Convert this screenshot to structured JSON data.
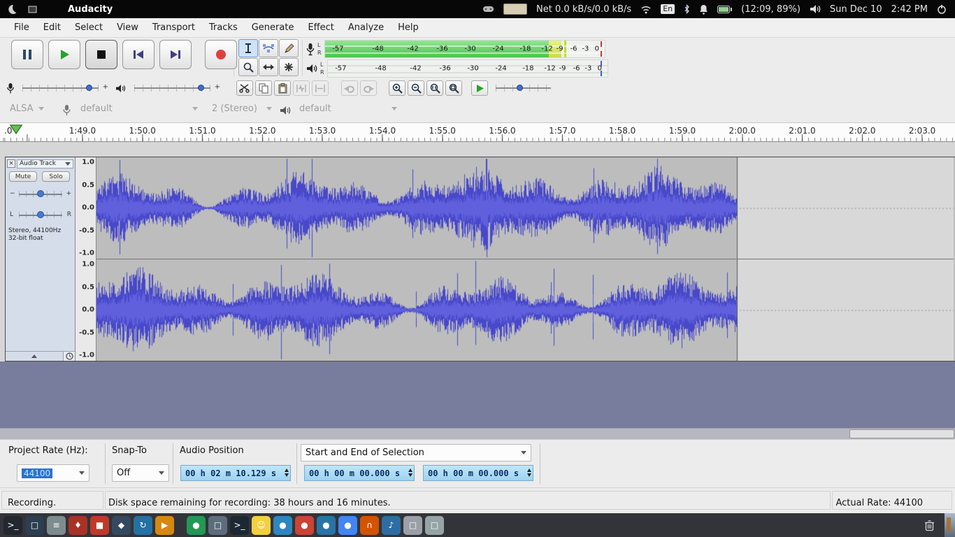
{
  "sysbar": {
    "app_title": "Audacity",
    "net": "Net 0.0 kB/s/0.0 kB/s",
    "lang": "En",
    "battery_text": "(12:09, 89%)",
    "date": "Sun Dec 10",
    "time": "2:42 PM"
  },
  "menubar": {
    "items": [
      "File",
      "Edit",
      "Select",
      "View",
      "Transport",
      "Tracks",
      "Generate",
      "Effect",
      "Analyze",
      "Help"
    ]
  },
  "meters": {
    "l": "L",
    "r": "R"
  },
  "meter_ticks": [
    "-57",
    "-48",
    "-42",
    "-36",
    "-30",
    "-24",
    "-18",
    "-12",
    "-9",
    "-6",
    "-3",
    "0"
  ],
  "mixer": {
    "plus": "+"
  },
  "device": {
    "host": "ALSA",
    "input": "default",
    "channels": "2 (Stereo)",
    "output": "default"
  },
  "timeline": {
    "partial": ".0",
    "labels": [
      "1:49.0",
      "1:50.0",
      "1:51.0",
      "1:52.0",
      "1:53.0",
      "1:54.0",
      "1:55.0",
      "1:56.0",
      "1:57.0",
      "1:58.0",
      "1:59.0",
      "2:00.0",
      "2:01.0",
      "2:02.0",
      "2:03.0"
    ]
  },
  "track": {
    "close": "×",
    "name": "Audio Track",
    "mute": "Mute",
    "solo": "Solo",
    "gain_minus": "−",
    "gain_plus": "+",
    "pan_left": "L",
    "pan_right": "R",
    "info_line1": "Stereo, 44100Hz",
    "info_line2": "32-bit float",
    "scale": [
      "1.0",
      "0.5",
      "0.0",
      "-0.5",
      "-1.0"
    ]
  },
  "selection_toolbar": {
    "project_rate_label": "Project Rate (Hz):",
    "project_rate": "44100",
    "snap_label": "Snap-To",
    "snap_value": "Off",
    "audio_position_label": "Audio Position",
    "audio_position": "00 h 02 m 10.129 s",
    "selection_mode": "Start and End of Selection",
    "selection_start": "00 h 00 m 00.000 s",
    "selection_end": "00 h 00 m 00.000 s"
  },
  "statusbar": {
    "state": "Recording.",
    "disk": "Disk space remaining for recording: 38 hours and 16 minutes.",
    "rate": "Actual Rate: 44100"
  },
  "colors": {
    "waveform": "#4848cb",
    "meter_green": "#4cc44c",
    "record_red": "#e03e3e",
    "play_green": "#28a32c",
    "track_panel": "#d4dde9",
    "canvas_background": "#787d9d"
  },
  "taskbar": {
    "items": [
      {
        "name": "terminal",
        "color": "#23272e",
        "glyph": ">_"
      },
      {
        "name": "display-app",
        "color": "#2c3e50",
        "glyph": "□"
      },
      {
        "name": "file-manager",
        "color": "#7f8c8d",
        "glyph": "≡"
      },
      {
        "name": "text-editor",
        "color": "#a93226",
        "glyph": "♦"
      },
      {
        "name": "package-manager",
        "color": "#c0392b",
        "glyph": "■"
      },
      {
        "name": "settings-app",
        "color": "#34495e",
        "glyph": "◆"
      },
      {
        "name": "sync-app",
        "color": "#2471a3",
        "glyph": "↻"
      },
      {
        "name": "media-app",
        "color": "#d68910",
        "glyph": "▶"
      },
      {
        "name": "android-app",
        "color": "#229954",
        "glyph": "●"
      },
      {
        "name": "vm-app",
        "color": "#5d6d7e",
        "glyph": "□"
      },
      {
        "name": "terminal-2",
        "color": "#1c2833",
        "glyph": ">_"
      },
      {
        "name": "chat-app",
        "color": "#f4d03f",
        "glyph": "☺"
      },
      {
        "name": "web-browser",
        "color": "#2e86c1",
        "glyph": "●"
      },
      {
        "name": "media-player",
        "color": "#cb4335",
        "glyph": "●"
      },
      {
        "name": "blue-app",
        "color": "#2874a6",
        "glyph": "●"
      },
      {
        "name": "chrome-browser",
        "color": "#4285f4",
        "glyph": "●"
      },
      {
        "name": "audio-app",
        "color": "#d35400",
        "glyph": "∩"
      },
      {
        "name": "music-app",
        "color": "#2e6da4",
        "glyph": "♪"
      },
      {
        "name": "window-1",
        "color": "#9aa0a6",
        "glyph": "□"
      },
      {
        "name": "window-2",
        "color": "#95a5a6",
        "glyph": "□"
      }
    ]
  }
}
